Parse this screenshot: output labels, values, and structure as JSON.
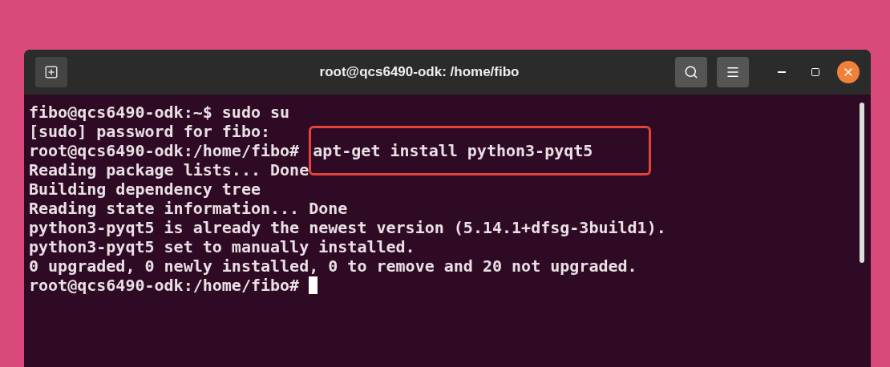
{
  "window": {
    "title": "root@qcs6490-odk: /home/fibo"
  },
  "terminal": {
    "lines": [
      {
        "text": "fibo@qcs6490-odk:~$ sudo su"
      },
      {
        "text": "[sudo] password for fibo:"
      },
      {
        "text": "root@qcs6490-odk:/home/fibo#",
        "command": "apt-get install python3-pyqt5",
        "highlighted": true
      },
      {
        "text": "Reading package lists... Done"
      },
      {
        "text": "Building dependency tree"
      },
      {
        "text": "Reading state information... Done"
      },
      {
        "text": "python3-pyqt5 is already the newest version (5.14.1+dfsg-3build1)."
      },
      {
        "text": "python3-pyqt5 set to manually installed."
      },
      {
        "text": "0 upgraded, 0 newly installed, 0 to remove and 20 not upgraded."
      },
      {
        "text": "root@qcs6490-odk:/home/fibo#",
        "cursor": true
      }
    ]
  }
}
